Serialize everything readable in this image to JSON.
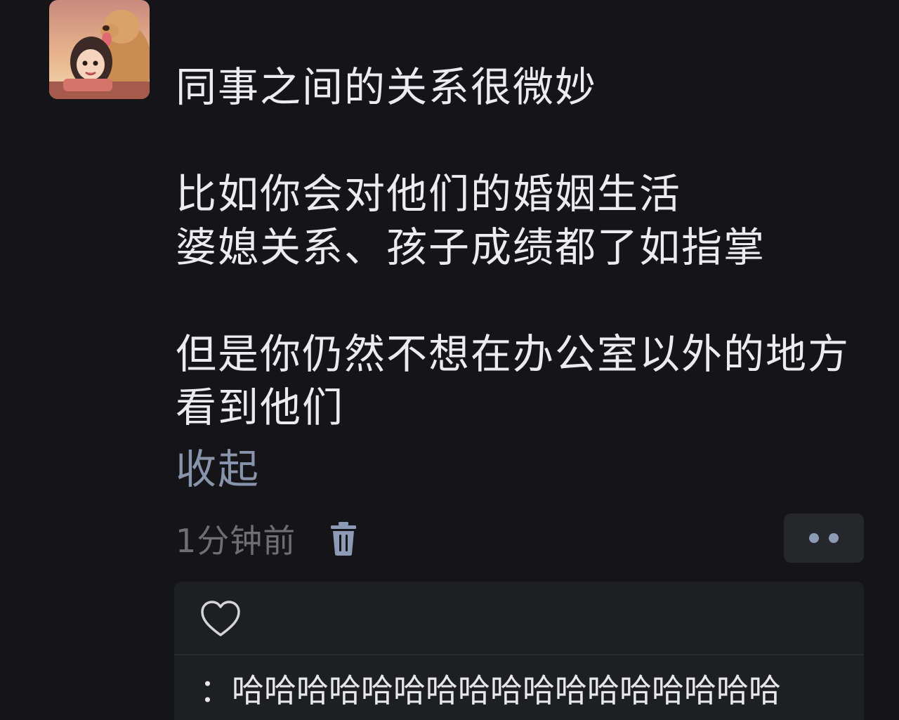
{
  "post": {
    "lines": [
      "同事之间的关系很微妙",
      "",
      "比如你会对他们的婚姻生活",
      "婆媳关系、孩子成绩都了如指掌",
      "",
      "但是你仍然不想在办公室以外的地方",
      "看到他们"
    ],
    "collapse_label": "收起",
    "timestamp": "1分钟前"
  },
  "icons": {
    "delete": "trash-icon",
    "more": "more-dots-icon",
    "like": "heart-icon"
  },
  "comment": {
    "text": "：哈哈哈哈哈哈哈哈哈哈哈哈哈哈哈哈哈"
  },
  "colors": {
    "background": "#151517",
    "link": "#8794ab",
    "panel": "#1e1f22"
  }
}
